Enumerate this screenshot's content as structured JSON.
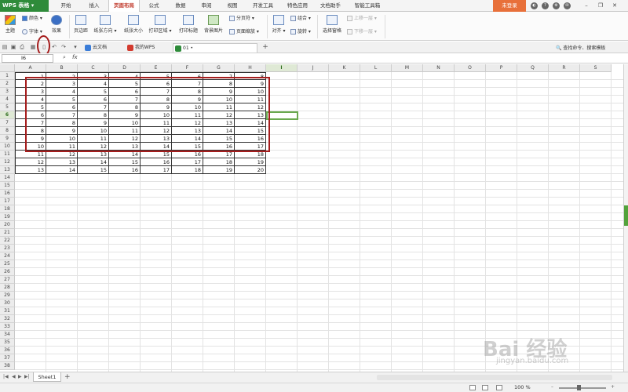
{
  "app": {
    "name": "WPS 表格",
    "login": "未登录",
    "menu_tabs": [
      "开始",
      "插入",
      "页面布局",
      "公式",
      "数据",
      "审阅",
      "视图",
      "开发工具",
      "特色应用",
      "文档助手",
      "智能工具箱"
    ],
    "active_tab": "页面布局"
  },
  "ribbon": {
    "theme": "主题",
    "colors": "颜色",
    "fonts": "字体",
    "effects": "效果",
    "margins": "页边距",
    "orientation": "纸张方向",
    "paper_size": "纸张大小",
    "print_area": "打印区域",
    "print_titles": "打印标题",
    "background": "背景图片",
    "page_break": "分页符",
    "page_scale": "页面缩放",
    "align": "对齐",
    "group": "组合",
    "rotate": "旋转",
    "selection_pane": "选择窗格",
    "bring_forward": "上移一层",
    "send_backward": "下移一层"
  },
  "doc_tabs": [
    {
      "label": "云文档",
      "color": "#3b7dd8"
    },
    {
      "label": "我的WPS",
      "color": "#d33b2f"
    },
    {
      "label": "01",
      "color": "#2e8b3a",
      "active": true
    }
  ],
  "find_command": "查找命令、搜索模板",
  "formula_bar": {
    "name_box": "I6",
    "fx": "fx",
    "value": ""
  },
  "grid": {
    "columns": [
      "A",
      "B",
      "C",
      "D",
      "E",
      "F",
      "G",
      "H",
      "I",
      "J",
      "K",
      "L",
      "M",
      "N",
      "O",
      "P",
      "Q",
      "R",
      "S"
    ],
    "selected_column": "I",
    "selected_row": 6,
    "row_count": 38,
    "data": [
      [
        1,
        2,
        3,
        4,
        5,
        6,
        7,
        8
      ],
      [
        2,
        3,
        4,
        5,
        6,
        7,
        8,
        9
      ],
      [
        3,
        4,
        5,
        6,
        7,
        8,
        9,
        10
      ],
      [
        4,
        5,
        6,
        7,
        8,
        9,
        10,
        11
      ],
      [
        5,
        6,
        7,
        8,
        9,
        10,
        11,
        12
      ],
      [
        6,
        7,
        8,
        9,
        10,
        11,
        12,
        13
      ],
      [
        7,
        8,
        9,
        10,
        11,
        12,
        13,
        14
      ],
      [
        8,
        9,
        10,
        11,
        12,
        13,
        14,
        15
      ],
      [
        9,
        10,
        11,
        12,
        13,
        14,
        15,
        16
      ],
      [
        10,
        11,
        12,
        13,
        14,
        15,
        16,
        17
      ],
      [
        11,
        12,
        13,
        14,
        15,
        16,
        17,
        18
      ],
      [
        12,
        13,
        14,
        15,
        16,
        17,
        18,
        19
      ],
      [
        13,
        14,
        15,
        16,
        17,
        18,
        19,
        20
      ]
    ]
  },
  "sheet_tabs": [
    "Sheet1"
  ],
  "status": {
    "zoom": "100 %"
  },
  "watermark": {
    "main": "Bai 经验",
    "sub": "jingyan.baidu.com"
  },
  "colors": {
    "brand_green": "#2e8b3a",
    "highlight_red": "#a51c1c",
    "login_orange": "#e8703a"
  }
}
